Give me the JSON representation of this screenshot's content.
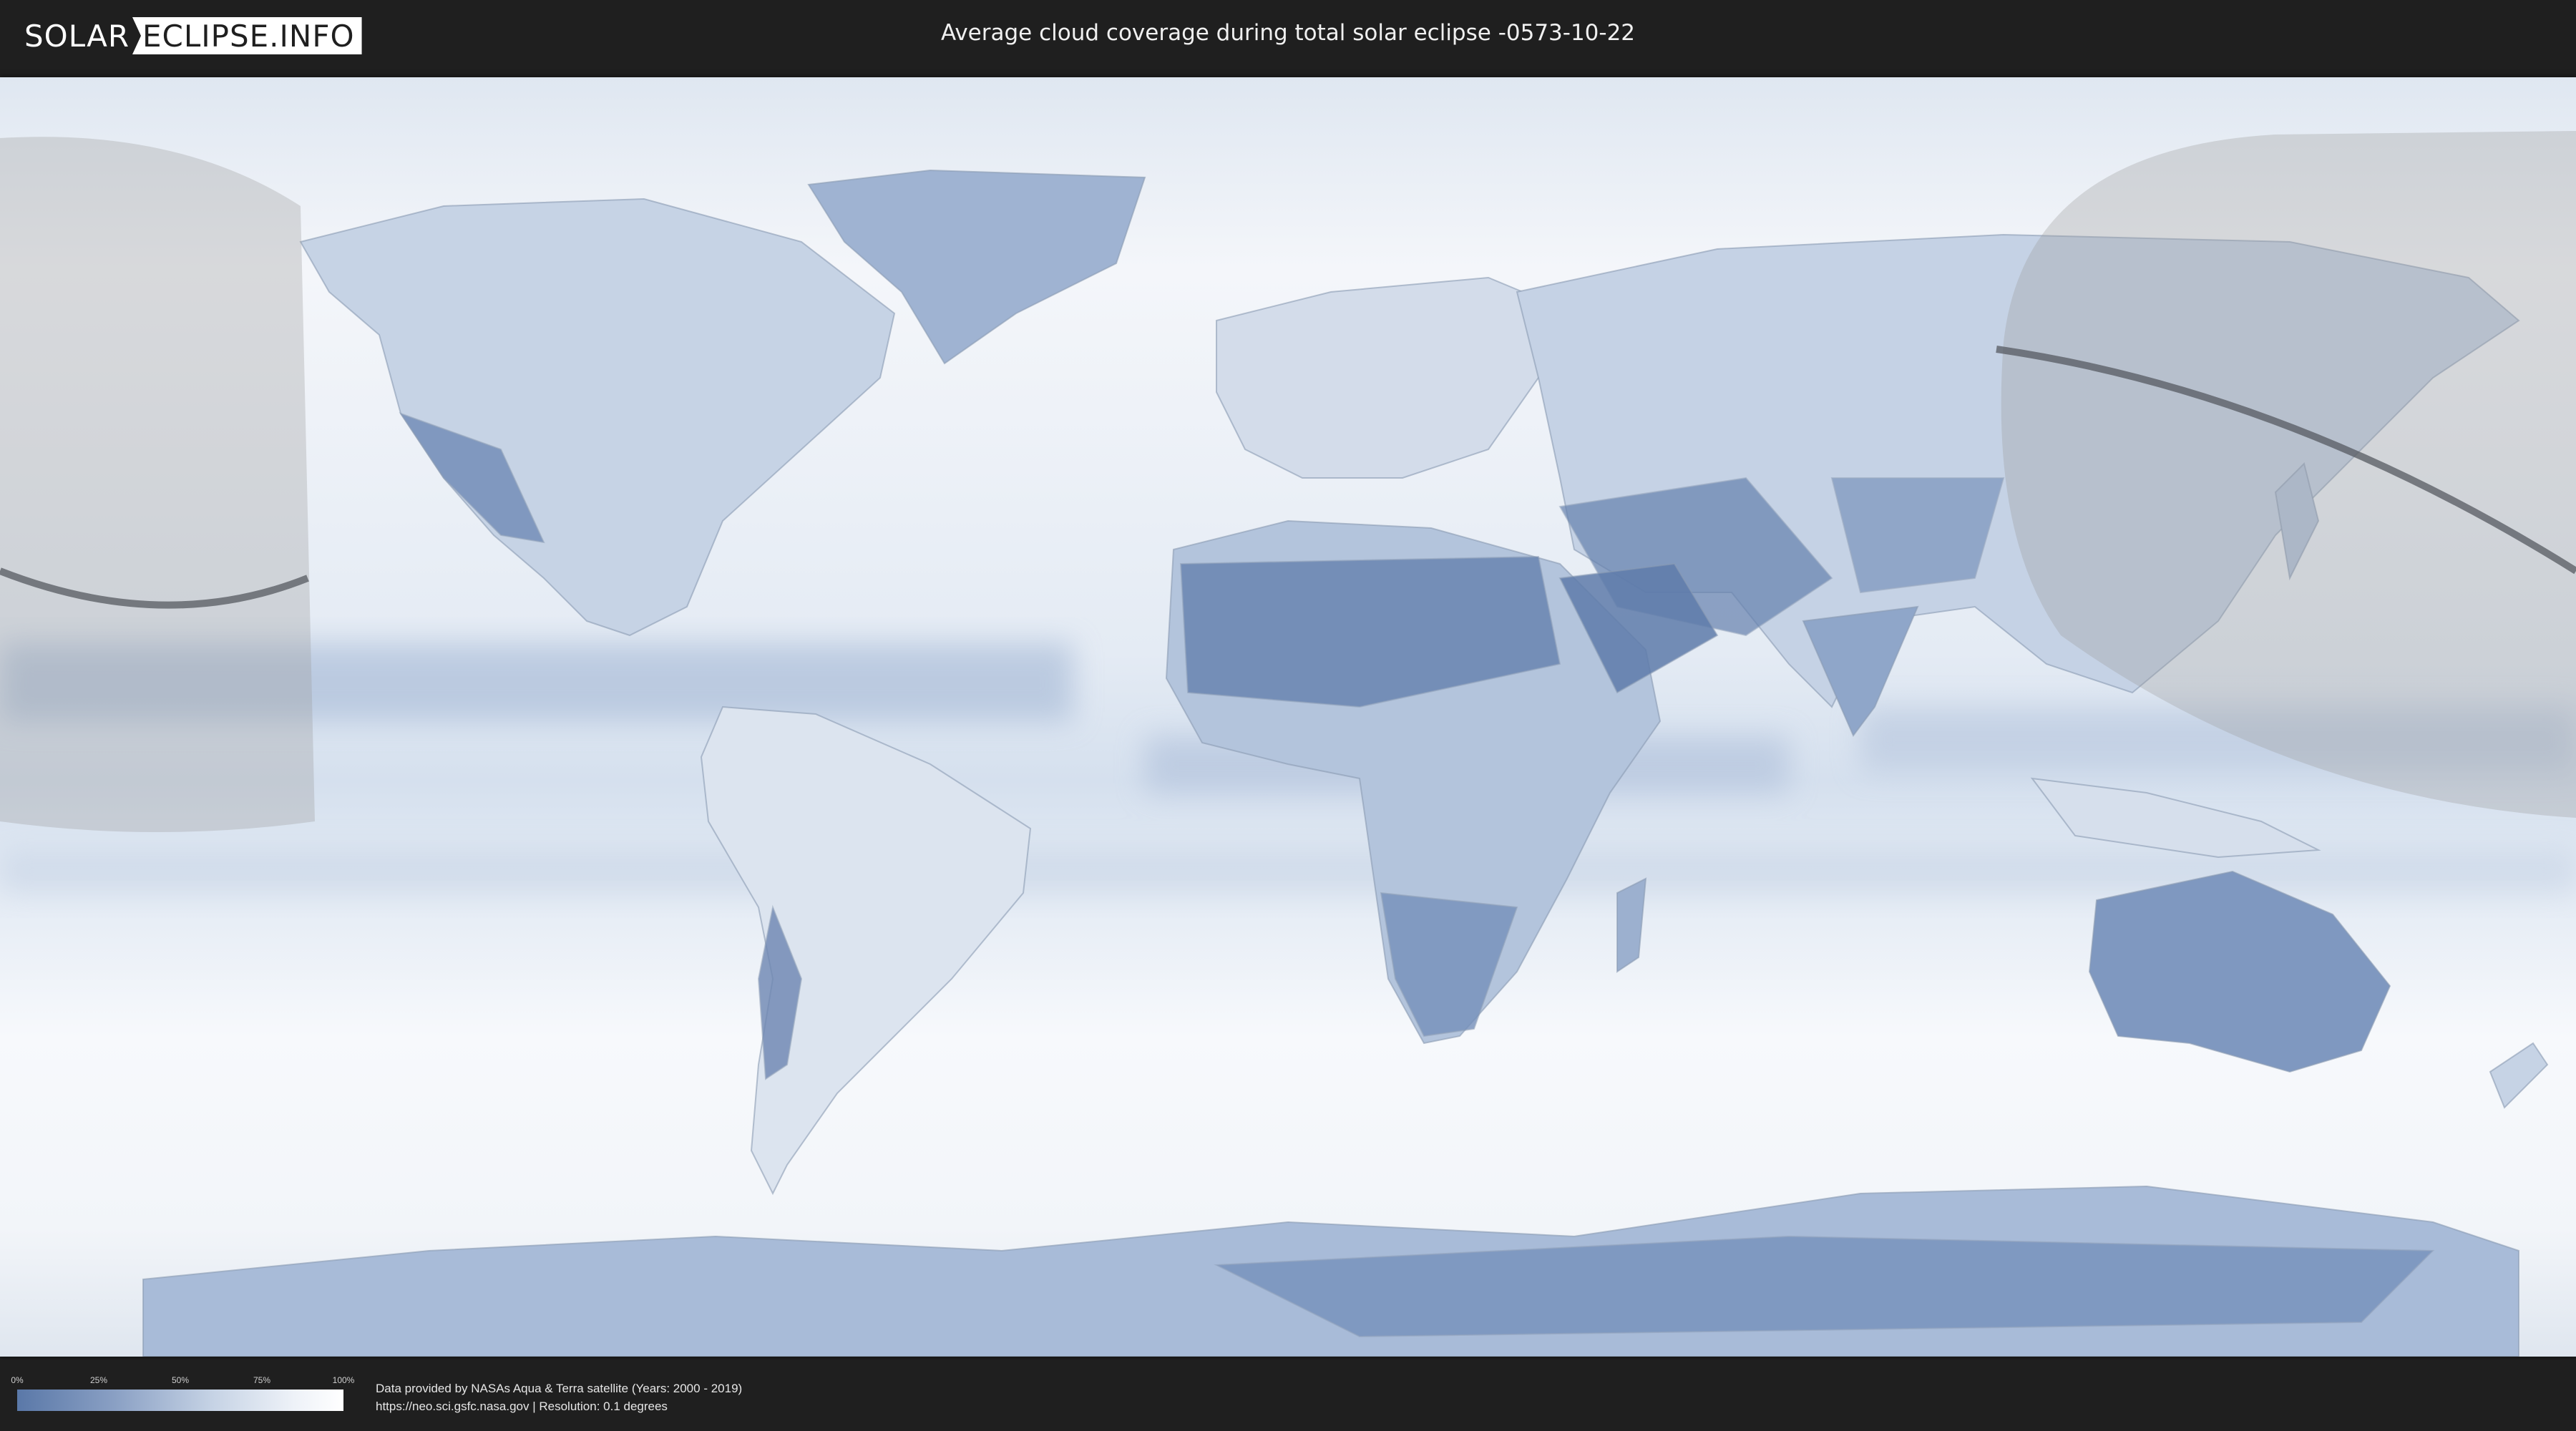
{
  "header": {
    "logo_left": "SOLAR",
    "logo_right": "ECLIPSE.INFO",
    "title": "Average cloud coverage during total solar eclipse -0573-10-22"
  },
  "legend": {
    "ticks": [
      "0%",
      "25%",
      "50%",
      "75%",
      "100%"
    ],
    "gradient_colors": [
      "#5a78a8",
      "#8aa0c4",
      "#c6d3e5",
      "#eef2f8",
      "#ffffff"
    ]
  },
  "credits": {
    "line1": "Data provided by NASAs Aqua & Terra satellite (Years: 2000 - 2019)",
    "line2": "https://neo.sci.gsfc.nasa.gov | Resolution: 0.1 degrees"
  },
  "map": {
    "projection": "equirectangular",
    "layers": [
      "cloud-coverage",
      "country-borders",
      "night-shadow",
      "eclipse-path"
    ],
    "colors": {
      "clear": "#5b7aa9",
      "cloudy": "#ffffff",
      "shadow": "#9a9a9a",
      "path": "#555a60"
    }
  }
}
